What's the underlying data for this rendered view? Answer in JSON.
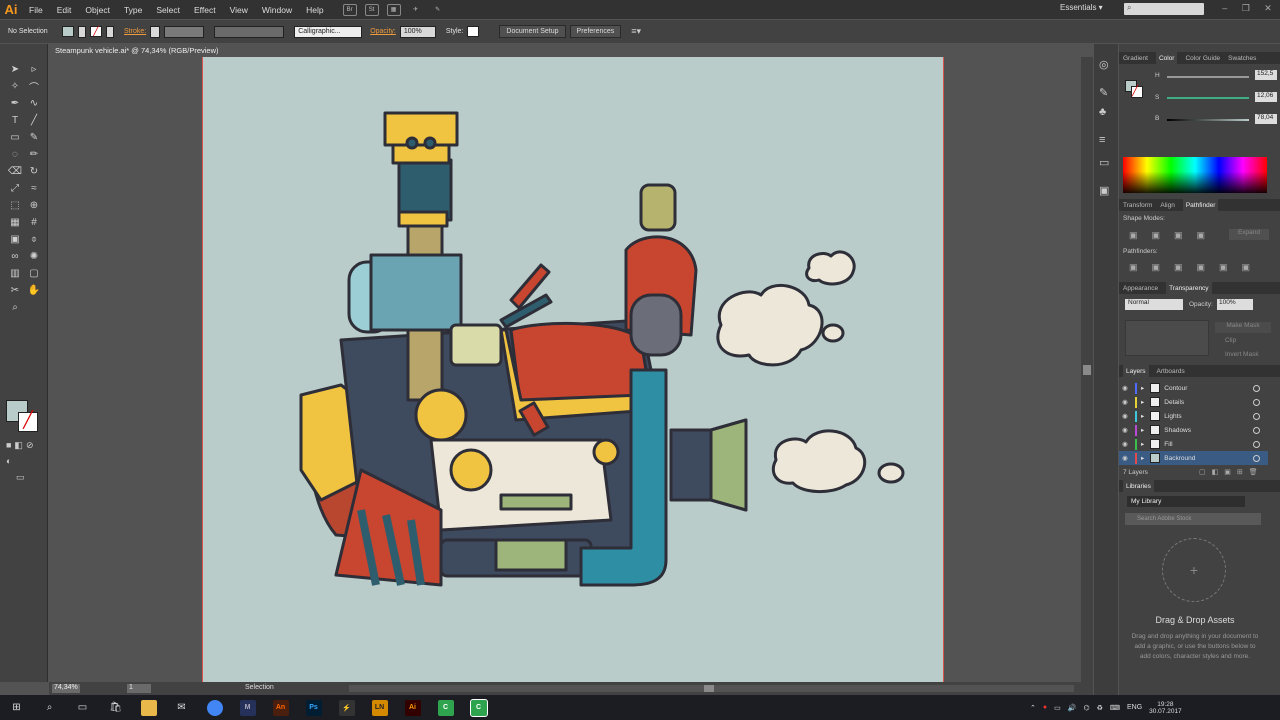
{
  "menu": {
    "logo": "Ai",
    "items": [
      "File",
      "Edit",
      "Object",
      "Type",
      "Select",
      "Effect",
      "View",
      "Window",
      "Help"
    ],
    "bridge": "Br",
    "stock": "St",
    "workspace": "Essentials ▾"
  },
  "control": {
    "selection": "No Selection",
    "stroke": "Stroke:",
    "brush": "Calligraphic...",
    "opacity_label": "Opacity:",
    "opacity": "100%",
    "style_label": "Style:",
    "doc_setup": "Document Setup",
    "preferences": "Preferences"
  },
  "document": {
    "tab": "Steampunk vehicle.ai* @ 74,34% (RGB/Preview)"
  },
  "status": {
    "zoom": "74,34%",
    "artboard": "1",
    "tool": "Selection"
  },
  "panels": {
    "color_tabs": [
      "Gradient",
      "Color",
      "Color Guide",
      "Swatches"
    ],
    "hsb": [
      {
        "l": "H",
        "v": "152,5"
      },
      {
        "l": "S",
        "v": "12,06"
      },
      {
        "l": "B",
        "v": "78,04"
      }
    ],
    "tr_tabs": [
      "Transform",
      "Align",
      "Pathfinder"
    ],
    "shape_modes": "Shape Modes:",
    "expand": "Expand",
    "pathfinders": "Pathfinders:",
    "ap_tabs": [
      "Appearance",
      "Transparency"
    ],
    "blend": "Normal",
    "opacity_label": "Opacity:",
    "opacity": "100%",
    "make_mask": "Make Mask",
    "clip": "Clip",
    "invert": "Invert Mask",
    "layer_tabs": [
      "Layers",
      "Artboards"
    ],
    "layers": [
      {
        "name": "Contour",
        "color": "#4f6cff"
      },
      {
        "name": "Details",
        "color": "#e2d23a"
      },
      {
        "name": "Lights",
        "color": "#3ec8e0"
      },
      {
        "name": "Shadows",
        "color": "#b84ad6"
      },
      {
        "name": "Fill",
        "color": "#3cc04a"
      },
      {
        "name": "Backround",
        "color": "#e44b4b"
      }
    ],
    "layer_count": "7 Layers",
    "libraries": "Libraries",
    "my_library": "My Library",
    "search_stock": "Search Adobe Stock",
    "dd_title": "Drag & Drop Assets",
    "dd_text": "Drag and drop anything in your document to add a graphic, or use the buttons below to add colors, character styles and more."
  },
  "taskbar": {
    "lang": "ENG",
    "time": "19:28",
    "date": "30.07.2017"
  }
}
